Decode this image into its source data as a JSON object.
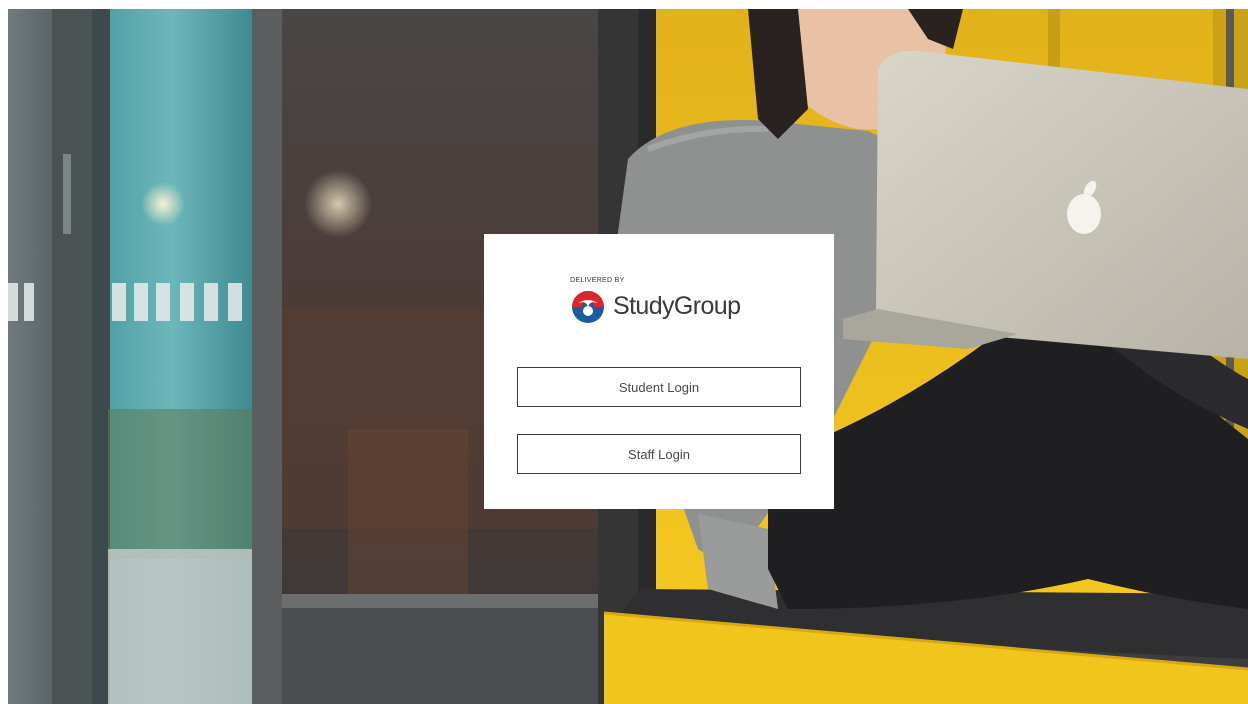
{
  "brand": {
    "delivered_by": "DELIVERED BY",
    "name": "StudyGroup",
    "logo_icon": "studygroup-logo-icon",
    "colors": {
      "red": "#d7282f",
      "blue": "#1d5c9c",
      "text": "#3a3a3a"
    }
  },
  "login": {
    "student_label": "Student Login",
    "staff_label": "Staff Login"
  },
  "background": {
    "image": "student-with-laptop-photo",
    "accent_yellow": "#f2c51d"
  }
}
